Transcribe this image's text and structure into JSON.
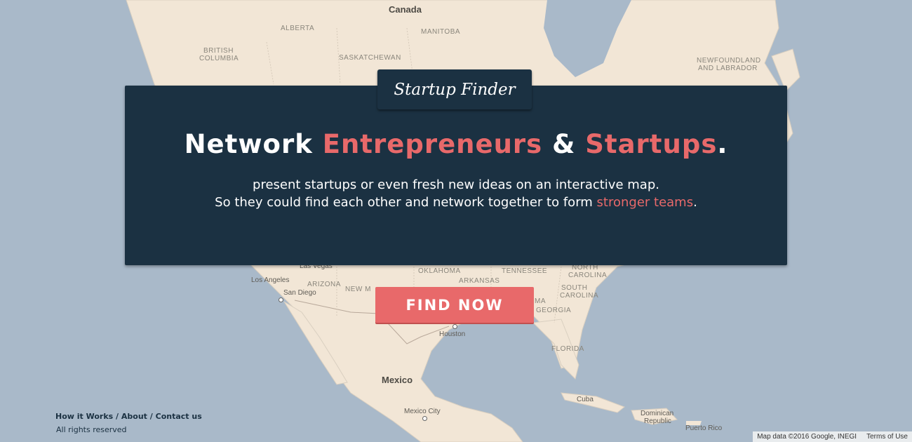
{
  "brand": {
    "name": "Startup Finder"
  },
  "headline": {
    "part1": "Network ",
    "accent1": "Entrepreneurs",
    "part2": " & ",
    "accent2": "Startups",
    "part3": "."
  },
  "tagline": {
    "line1": "present startups or even fresh new ideas on an interactive map.",
    "line2_prefix": "So they could find each other and network together to form ",
    "line2_accent": "stronger teams",
    "line2_suffix": "."
  },
  "cta": {
    "label": "FIND NOW"
  },
  "footer": {
    "links": [
      "How it Works",
      "About",
      "Contact us"
    ],
    "separator": " / ",
    "rights": "All rights reserved"
  },
  "map": {
    "attribution": "Map data ©2016 Google, INEGI",
    "terms": "Terms of Use",
    "labels": {
      "canada": "Canada",
      "alberta": "ALBERTA",
      "manitoba": "MANITOBA",
      "british_columbia_1": "BRITISH",
      "british_columbia_2": "COLUMBIA",
      "saskatchewan": "SASKATCHEWAN",
      "newfoundland_1": "NEWFOUNDLAND",
      "newfoundland_2": "AND LABRADOR",
      "las_vegas": "Las Vegas",
      "los_angeles": "Los Angeles",
      "san_diego": "San Diego",
      "arizona": "ARIZONA",
      "new_mexico": "NEW M",
      "oklahoma": "OKLAHOMA",
      "arkansas": "ARKANSAS",
      "tennessee": "TENNESSEE",
      "north_carolina_1": "NORTH",
      "north_carolina_2": "CAROLINA",
      "south_carolina_1": "SOUTH",
      "south_carolina_2": "CAROLINA",
      "alabama_partial": "MA",
      "georgia": "GEORGIA",
      "houston": "Houston",
      "florida": "FLORIDA",
      "mexico": "Mexico",
      "mexico_city": "Mexico City",
      "cuba": "Cuba",
      "dominican_1": "Dominican",
      "dominican_2": "Republic",
      "puerto_rico": "Puerto Rico"
    }
  },
  "colors": {
    "panel": "#1b3142",
    "accent": "#e8696a",
    "land": "#f2e6d6",
    "water": "#a9b9c9"
  }
}
